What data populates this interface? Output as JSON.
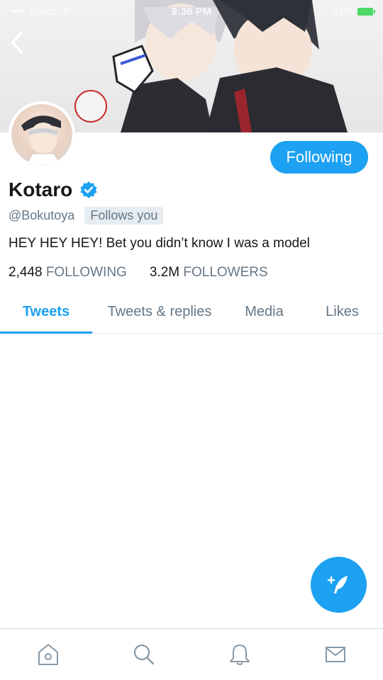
{
  "status_bar": {
    "carrier": "Boost",
    "time": "9:36 PM",
    "battery": "31%"
  },
  "profile": {
    "display_name": "Kotaro",
    "handle": "@Bokutoya",
    "follows_you_badge": "Follows you",
    "bio": "HEY HEY HEY! Bet you didn’t know I was a model",
    "following_count": "2,448",
    "following_label": "FOLLOWING",
    "followers_count": "3.2M",
    "followers_label": "FOLLOWERS",
    "follow_button_label": "Following"
  },
  "tabs": [
    {
      "label": "Tweets",
      "active": true
    },
    {
      "label": "Tweets & replies",
      "active": false
    },
    {
      "label": "Media",
      "active": false
    },
    {
      "label": "Likes",
      "active": false
    }
  ],
  "bottom_nav": [
    {
      "icon": "home-icon"
    },
    {
      "icon": "search-icon"
    },
    {
      "icon": "notifications-icon"
    },
    {
      "icon": "messages-icon"
    }
  ],
  "colors": {
    "accent": "#1da1f2",
    "secondary_text": "#657786",
    "primary_text": "#14171a"
  }
}
